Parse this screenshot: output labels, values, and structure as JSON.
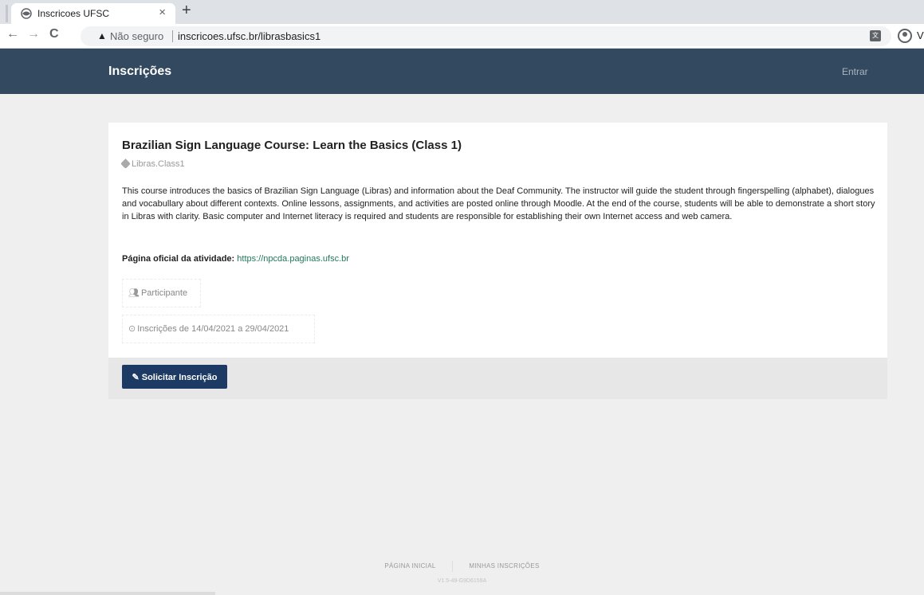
{
  "browser": {
    "tab_title": "Inscricoes UFSC",
    "tab_close": "×",
    "new_tab": "+",
    "back": "←",
    "forward": "→",
    "reload": "C",
    "security_icon": "warning-icon",
    "security_label": "Não seguro",
    "url": "inscricoes.ufsc.br/librasbasics1",
    "profile_letter": "V"
  },
  "header": {
    "brand": "Inscrições",
    "login": "Entrar"
  },
  "course": {
    "title": "Brazilian Sign Language Course: Learn the Basics (Class 1)",
    "tag": "Libras.Class1",
    "description": "This course introduces the basics of Brazilian Sign Language (Libras) and information about the Deaf Community. The instructor will guide the student through fingerspelling (alphabet), dialogues and vocabullary about different contexts. Online lessons, assignments, and activities are posted online through Moodle. At the end of the course, students will be able to demonstrate a short story in Libras with clarity. Basic computer and Internet literacy is required and students are responsible for establishing their own Internet access and web camera.",
    "official_label": "Página oficial da atividade:",
    "official_link": "https://npcda.paginas.ufsc.br",
    "audience": "Participante",
    "audience_icon": "users-icon",
    "period": "Inscrições de 14/04/2021 a 29/04/2021",
    "period_icon": "clock-icon",
    "button_label": "Solicitar Inscrição",
    "button_icon": "edit-icon"
  },
  "footer": {
    "home": "PÁGINA INICIAL",
    "my_registrations": "MINHAS INSCRIÇÕES",
    "version": "V1.5-49-G9D6159A"
  },
  "colors": {
    "header_bg": "#33495f",
    "button_bg": "#1c3a63",
    "link": "#22795a"
  }
}
